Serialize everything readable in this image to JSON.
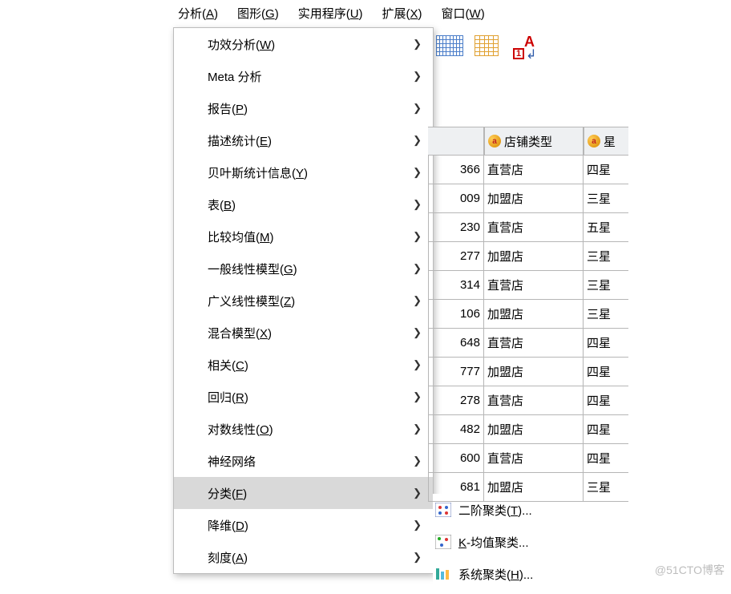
{
  "menubar": {
    "items": [
      {
        "pre": "分析(",
        "u": "A",
        "post": ")"
      },
      {
        "pre": "图形(",
        "u": "G",
        "post": ")"
      },
      {
        "pre": "实用程序(",
        "u": "U",
        "post": ")"
      },
      {
        "pre": "扩展(",
        "u": "X",
        "post": ")"
      },
      {
        "pre": "窗口(",
        "u": "W",
        "post": ")"
      }
    ]
  },
  "toolbar": {
    "mark_digit": "1",
    "mark_letter": "A"
  },
  "menu": {
    "items": [
      {
        "pre": "功效分析(",
        "u": "W",
        "post": ")",
        "has_sub": true
      },
      {
        "pre": "Meta 分析",
        "u": "",
        "post": "",
        "has_sub": true
      },
      {
        "pre": "报告(",
        "u": "P",
        "post": ")",
        "has_sub": true
      },
      {
        "pre": "描述统计(",
        "u": "E",
        "post": ")",
        "has_sub": true
      },
      {
        "pre": "贝叶斯统计信息(",
        "u": "Y",
        "post": ")",
        "has_sub": true
      },
      {
        "pre": "表(",
        "u": "B",
        "post": ")",
        "has_sub": true
      },
      {
        "pre": "比较均值(",
        "u": "M",
        "post": ")",
        "has_sub": true
      },
      {
        "pre": "一般线性模型(",
        "u": "G",
        "post": ")",
        "has_sub": true
      },
      {
        "pre": "广义线性模型(",
        "u": "Z",
        "post": ")",
        "has_sub": true
      },
      {
        "pre": "混合模型(",
        "u": "X",
        "post": ")",
        "has_sub": true
      },
      {
        "pre": "相关(",
        "u": "C",
        "post": ")",
        "has_sub": true
      },
      {
        "pre": "回归(",
        "u": "R",
        "post": ")",
        "has_sub": true
      },
      {
        "pre": "对数线性(",
        "u": "O",
        "post": ")",
        "has_sub": true
      },
      {
        "pre": "神经网络",
        "u": "",
        "post": "",
        "has_sub": true
      },
      {
        "pre": "分类(",
        "u": "F",
        "post": ")",
        "has_sub": true,
        "selected": true
      },
      {
        "pre": "降维(",
        "u": "D",
        "post": ")",
        "has_sub": true
      },
      {
        "pre": "刻度(",
        "u": "A",
        "post": ")",
        "has_sub": true
      }
    ]
  },
  "submenu": {
    "items": [
      {
        "pre": "二阶聚类(",
        "u": "T",
        "post": ")...",
        "icon": "cluster-two-icon"
      },
      {
        "pre": "",
        "u": "K",
        "post": "-均值聚类...",
        "icon": "cluster-k-icon"
      },
      {
        "pre": "系统聚类(",
        "u": "H",
        "post": ")...",
        "icon": "cluster-hier-icon"
      }
    ]
  },
  "grid": {
    "headers": {
      "num": "",
      "type": "店铺类型",
      "star": "星"
    },
    "header_badge": "a",
    "rows": [
      {
        "num": "366",
        "type": "直营店",
        "star": "四星"
      },
      {
        "num": "009",
        "type": "加盟店",
        "star": "三星"
      },
      {
        "num": "230",
        "type": "直营店",
        "star": "五星"
      },
      {
        "num": "277",
        "type": "加盟店",
        "star": "三星"
      },
      {
        "num": "314",
        "type": "直营店",
        "star": "三星"
      },
      {
        "num": "106",
        "type": "加盟店",
        "star": "三星"
      },
      {
        "num": "648",
        "type": "直营店",
        "star": "四星"
      },
      {
        "num": "777",
        "type": "加盟店",
        "star": "四星"
      },
      {
        "num": "278",
        "type": "直营店",
        "star": "四星"
      },
      {
        "num": "482",
        "type": "加盟店",
        "star": "四星"
      },
      {
        "num": "600",
        "type": "直营店",
        "star": "四星"
      },
      {
        "num": "681",
        "type": "加盟店",
        "star": "三星"
      }
    ]
  },
  "watermark": "@51CTO博客"
}
